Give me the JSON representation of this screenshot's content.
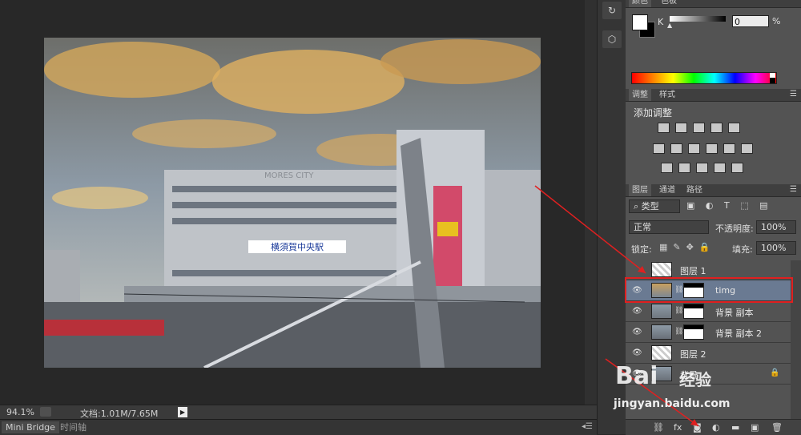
{
  "status_bar": {
    "zoom": "94.1%",
    "doc_info": "文档:1.01M/7.65M"
  },
  "bottom_tabs": [
    "Mini Bridge",
    "时间轴"
  ],
  "color_panel": {
    "tabs": [
      "颜色",
      "色板"
    ],
    "channel_label": "K",
    "value": "0",
    "unit": "%"
  },
  "adjustments_panel": {
    "tabs": [
      "调整",
      "样式"
    ],
    "title": "添加调整",
    "icons": [
      "brightness-icon",
      "levels-icon",
      "curves-icon",
      "exposure-icon",
      "vibrance-icon",
      "hue-icon",
      "color-balance-icon",
      "bw-icon",
      "photo-filter-icon",
      "channel-mixer-icon",
      "color-lookup-icon",
      "invert-icon",
      "posterize-icon",
      "threshold-icon",
      "gradient-map-icon",
      "selective-color-icon"
    ]
  },
  "layers_panel": {
    "tabs": [
      "图层",
      "通道",
      "路径"
    ],
    "filter_kind": "类型",
    "blend_mode": "正常",
    "opacity_label": "不透明度:",
    "opacity_value": "100%",
    "lock_label": "锁定:",
    "fill_label": "填充:",
    "fill_value": "100%",
    "layers": [
      {
        "name": "图层 1",
        "visible": false,
        "has_mask": false,
        "selected": false
      },
      {
        "name": "timg",
        "visible": true,
        "has_mask": true,
        "selected": true
      },
      {
        "name": "背景 副本",
        "visible": true,
        "has_mask": true,
        "selected": false
      },
      {
        "name": "背景 副本 2",
        "visible": true,
        "has_mask": true,
        "selected": false
      },
      {
        "name": "图层 2",
        "visible": true,
        "has_mask": false,
        "selected": false
      },
      {
        "name": "背景",
        "visible": true,
        "has_mask": false,
        "selected": false
      }
    ]
  },
  "photo": {
    "sign_text": "横須賀中央駅",
    "building_text": "MORES CITY"
  },
  "watermark": {
    "brand": "Bai",
    "brand2": "经验",
    "url": "jingyan.baidu.com"
  },
  "colors": {
    "highlight": "#e02020",
    "selected_layer": "#6a7a92"
  }
}
